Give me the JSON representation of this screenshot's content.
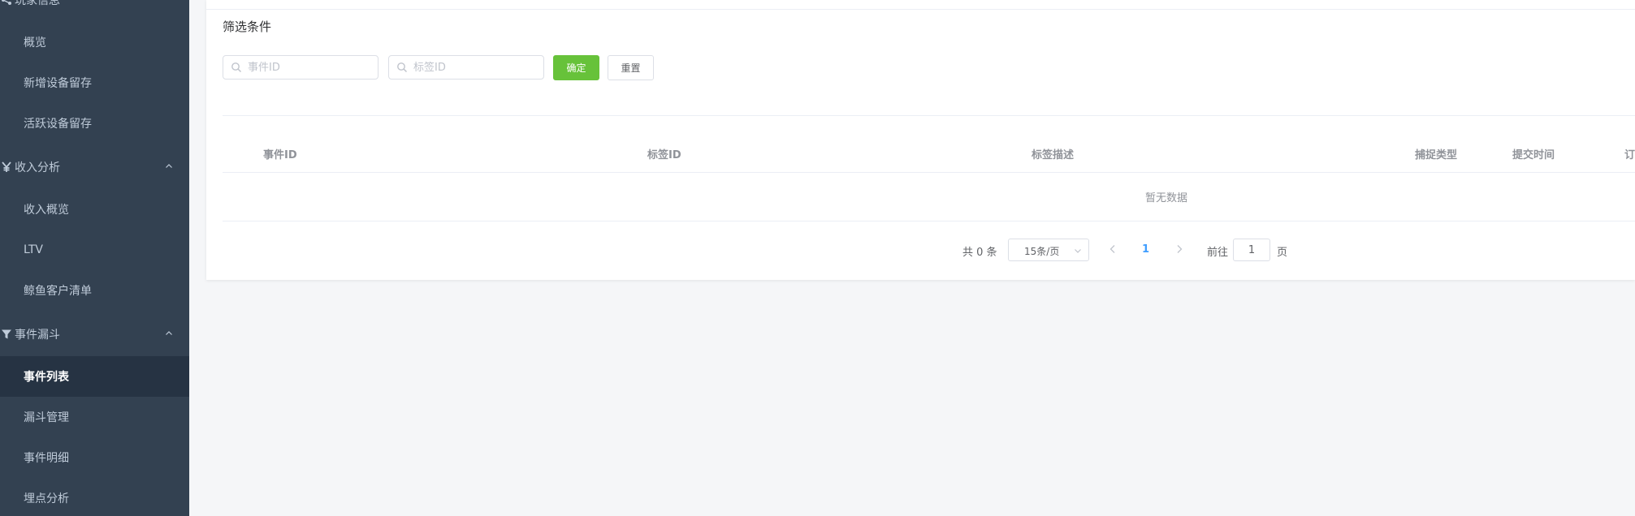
{
  "sidebar": {
    "groups": [
      {
        "icon": "share-icon",
        "label": "玩家信息"
      },
      {
        "icon": "yen-icon",
        "label": "收入分析"
      },
      {
        "icon": "filter-icon",
        "label": "事件漏斗"
      }
    ],
    "items": [
      {
        "label": "概览"
      },
      {
        "label": "新增设备留存"
      },
      {
        "label": "活跃设备留存"
      },
      {
        "label": "收入概览"
      },
      {
        "label": "LTV"
      },
      {
        "label": "鲸鱼客户清单"
      },
      {
        "label": "事件列表",
        "active": true
      },
      {
        "label": "漏斗管理"
      },
      {
        "label": "事件明细"
      },
      {
        "label": "埋点分析"
      }
    ]
  },
  "filter": {
    "title": "筛选条件",
    "event_id_placeholder": "事件ID",
    "tag_id_placeholder": "标签ID",
    "confirm_label": "确定",
    "reset_label": "重置"
  },
  "table": {
    "columns": [
      "事件ID",
      "标签ID",
      "标签描述",
      "捕捉类型",
      "提交时间",
      "订"
    ],
    "empty_text": "暂无数据"
  },
  "pagination": {
    "total_text": "共 0 条",
    "page_size": "15条/页",
    "current_page": "1",
    "goto_label": "前往",
    "goto_value": "1",
    "page_suffix": "页"
  },
  "colors": {
    "sidebar_bg": "#334151",
    "sidebar_active_bg": "#263343",
    "primary_button": "#67c23a",
    "current_page": "#409eff"
  }
}
